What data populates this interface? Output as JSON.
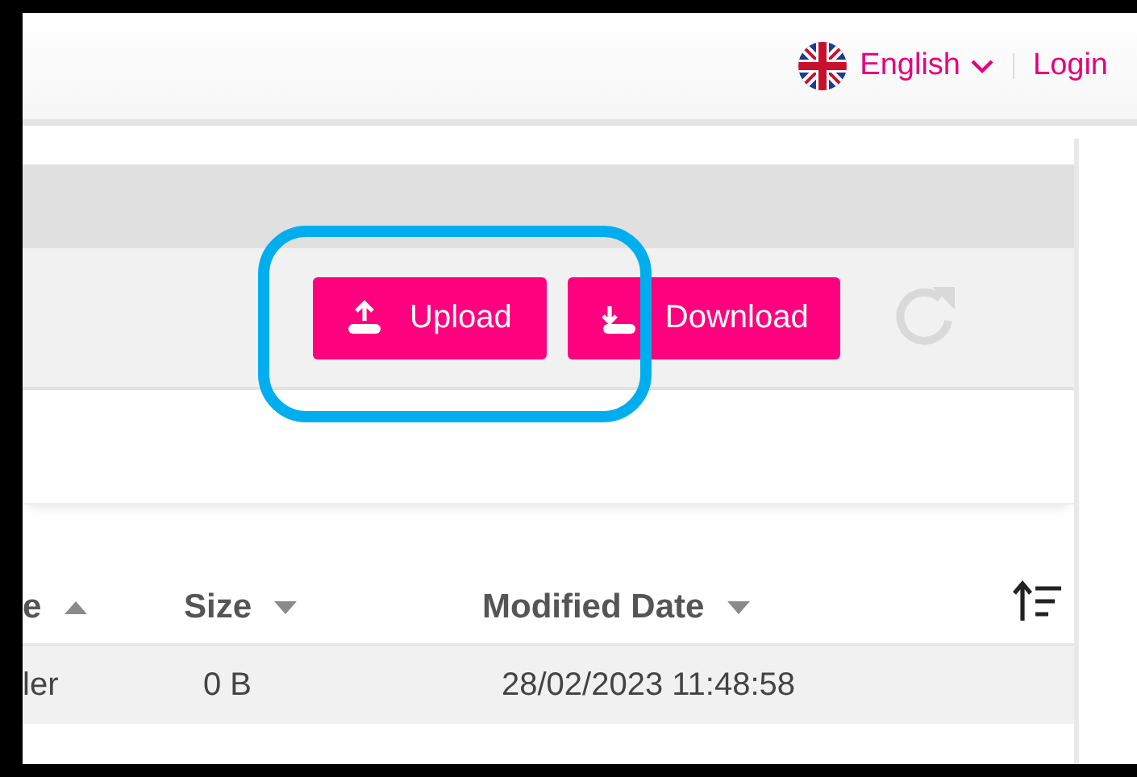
{
  "header": {
    "language": "English",
    "login": "Login"
  },
  "toolbar": {
    "buttons": [
      {
        "label": "Upload",
        "kind": "upload"
      },
      {
        "label": "Download",
        "kind": "download"
      }
    ],
    "refresh_disabled": true
  },
  "table": {
    "columns": [
      {
        "label": "e",
        "ascending": true
      },
      {
        "label": "Size",
        "ascending": false
      },
      {
        "label": "Modified Date",
        "ascending": false
      }
    ],
    "rows": [
      {
        "cells": [
          "ler",
          "0 B",
          "28/02/2023 11:48:58"
        ]
      }
    ]
  },
  "annotation": {
    "kind": "highlight"
  }
}
